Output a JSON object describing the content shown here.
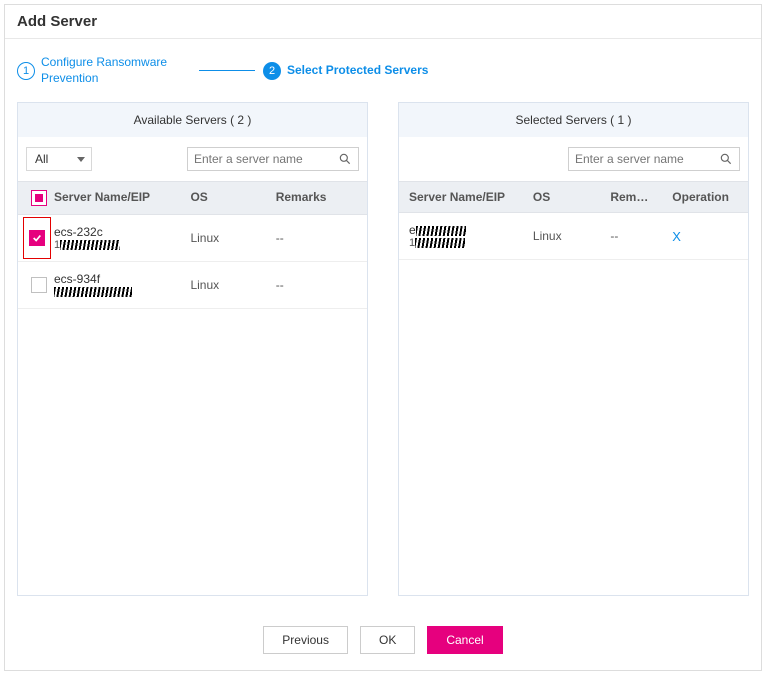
{
  "header": {
    "title": "Add Server"
  },
  "steps": {
    "step1": {
      "num": "1",
      "label": "Configure Ransomware Prevention"
    },
    "step2": {
      "num": "2",
      "label": "Select Protected Servers"
    }
  },
  "available": {
    "title": "Available Servers ( 2 )",
    "filter_value": "All",
    "search_placeholder": "Enter a server name",
    "headers": {
      "name": "Server Name/EIP",
      "os": "OS",
      "remarks": "Remarks"
    },
    "rows": [
      {
        "checked": true,
        "name": "ecs-232c",
        "sub": "1",
        "os": "Linux",
        "remarks": "--"
      },
      {
        "checked": false,
        "name": "ecs-934f",
        "sub": "",
        "os": "Linux",
        "remarks": "--"
      }
    ]
  },
  "selected": {
    "title": "Selected Servers ( 1 )",
    "search_placeholder": "Enter a server name",
    "headers": {
      "name": "Server Name/EIP",
      "os": "OS",
      "remarks": "Rem…",
      "operation": "Operation"
    },
    "rows": [
      {
        "name": "e",
        "sub": "1",
        "os": "Linux",
        "remarks": "--",
        "op": "X"
      }
    ]
  },
  "footer": {
    "previous": "Previous",
    "ok": "OK",
    "cancel": "Cancel"
  }
}
